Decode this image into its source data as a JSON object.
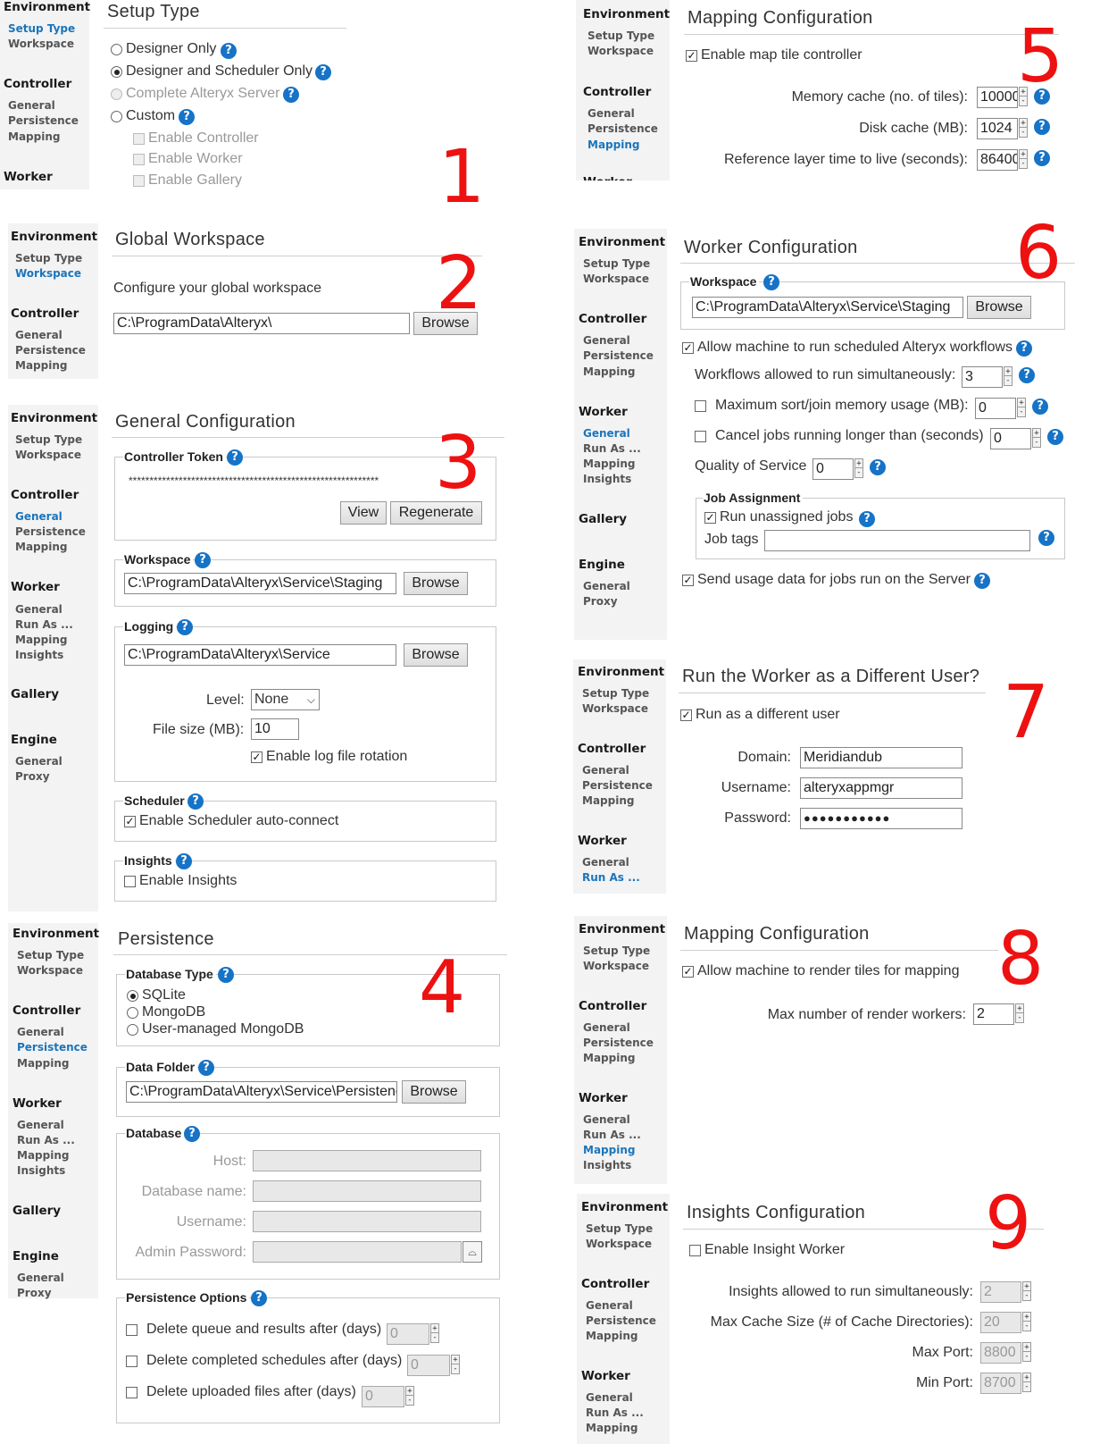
{
  "nav": {
    "environment": "Environment",
    "setup_type": "Setup Type",
    "workspace": "Workspace",
    "controller": "Controller",
    "general": "General",
    "persistence": "Persistence",
    "mapping": "Mapping",
    "worker": "Worker",
    "run_as": "Run As ...",
    "insights": "Insights",
    "gallery": "Gallery",
    "engine": "Engine",
    "proxy": "Proxy"
  },
  "help_glyph": "?",
  "check_glyph": "✓",
  "spin_up": "+",
  "spin_down": "-",
  "p1": {
    "title": "Setup Type",
    "number": "1",
    "options": [
      "Designer Only",
      "Designer and Scheduler Only",
      "Complete Alteryx Server",
      "Custom"
    ],
    "selected_option": "Designer and Scheduler Only",
    "sub_options": [
      "Enable Controller",
      "Enable Worker",
      "Enable Gallery"
    ]
  },
  "p2": {
    "title": "Global Workspace",
    "number": "2",
    "description": "Configure your global workspace",
    "path": "C:\\ProgramData\\Alteryx\\",
    "browse": "Browse"
  },
  "p3": {
    "title": "General Configuration",
    "number": "3",
    "token_legend": "Controller Token",
    "token_value": "************************************************************",
    "view": "View",
    "regenerate": "Regenerate",
    "workspace_legend": "Workspace",
    "workspace_path": "C:\\ProgramData\\Alteryx\\Service\\Staging",
    "browse": "Browse",
    "logging_legend": "Logging",
    "logging_path": "C:\\ProgramData\\Alteryx\\Service",
    "level_label": "Level:",
    "level_value": "None",
    "size_label": "File size (MB):",
    "size_value": "10",
    "rotation_label": "Enable log file rotation",
    "scheduler_legend": "Scheduler",
    "scheduler_label": "Enable Scheduler auto-connect",
    "insights_legend": "Insights",
    "insights_label": "Enable Insights"
  },
  "p4": {
    "title": "Persistence",
    "number": "4",
    "db_type_legend": "Database Type",
    "db_types": [
      "SQLite",
      "MongoDB",
      "User-managed MongoDB"
    ],
    "selected_db": "SQLite",
    "folder_legend": "Data Folder",
    "folder_path": "C:\\ProgramData\\Alteryx\\Service\\Persistence",
    "browse": "Browse",
    "db_legend": "Database",
    "host_label": "Host:",
    "dbname_label": "Database name:",
    "username_label": "Username:",
    "admin_pw_label": "Admin Password:",
    "eye_glyph": "⌓",
    "options_legend": "Persistence Options",
    "opt1": "Delete queue and results after (days)",
    "opt2": "Delete completed schedules after (days)",
    "opt3": "Delete uploaded files after (days)",
    "opt_value": "0"
  },
  "p5": {
    "title": "Mapping Configuration",
    "number": "5",
    "enable_label": "Enable map tile controller",
    "mem_label": "Memory cache (no. of tiles):",
    "mem_value": "10000",
    "disk_label": "Disk cache (MB):",
    "disk_value": "1024",
    "ttl_label": "Reference layer time to live (seconds):",
    "ttl_value": "86400"
  },
  "p6": {
    "title": "Worker Configuration",
    "number": "6",
    "workspace_legend": "Workspace",
    "workspace_path": "C:\\ProgramData\\Alteryx\\Service\\Staging",
    "browse": "Browse",
    "allow_label": "Allow machine to run scheduled Alteryx workflows",
    "simul_label": "Workflows allowed to run simultaneously:",
    "simul_value": "3",
    "mem_label": "Maximum sort/join memory usage (MB):",
    "mem_value": "0",
    "cancel_label": "Cancel jobs running longer than (seconds)",
    "cancel_value": "0",
    "qos_label": "Quality of Service",
    "qos_value": "0",
    "job_legend": "Job Assignment",
    "unassigned_label": "Run unassigned jobs",
    "tags_label": "Job tags",
    "usage_label": "Send usage data for jobs run on the Server"
  },
  "p7": {
    "title": "Run the Worker as a Different User?",
    "number": "7",
    "run_as_label": "Run as a different user",
    "domain_label": "Domain:",
    "domain_value": "Meridiandub",
    "username_label": "Username:",
    "username_value": "alteryxappmgr",
    "password_label": "Password:",
    "password_value": "●●●●●●●●●●●"
  },
  "p8": {
    "title": "Mapping Configuration",
    "number": "8",
    "allow_label": "Allow machine to render tiles for mapping",
    "max_label": "Max number of render workers:",
    "max_value": "2"
  },
  "p9": {
    "title": "Insights Configuration",
    "number": "9",
    "enable_label": "Enable Insight Worker",
    "simul_label": "Insights allowed to run simultaneously:",
    "simul_value": "2",
    "cache_label": "Max Cache Size (# of Cache Directories):",
    "cache_value": "20",
    "maxport_label": "Max Port:",
    "maxport_value": "8800",
    "minport_label": "Min Port:",
    "minport_value": "8700"
  }
}
